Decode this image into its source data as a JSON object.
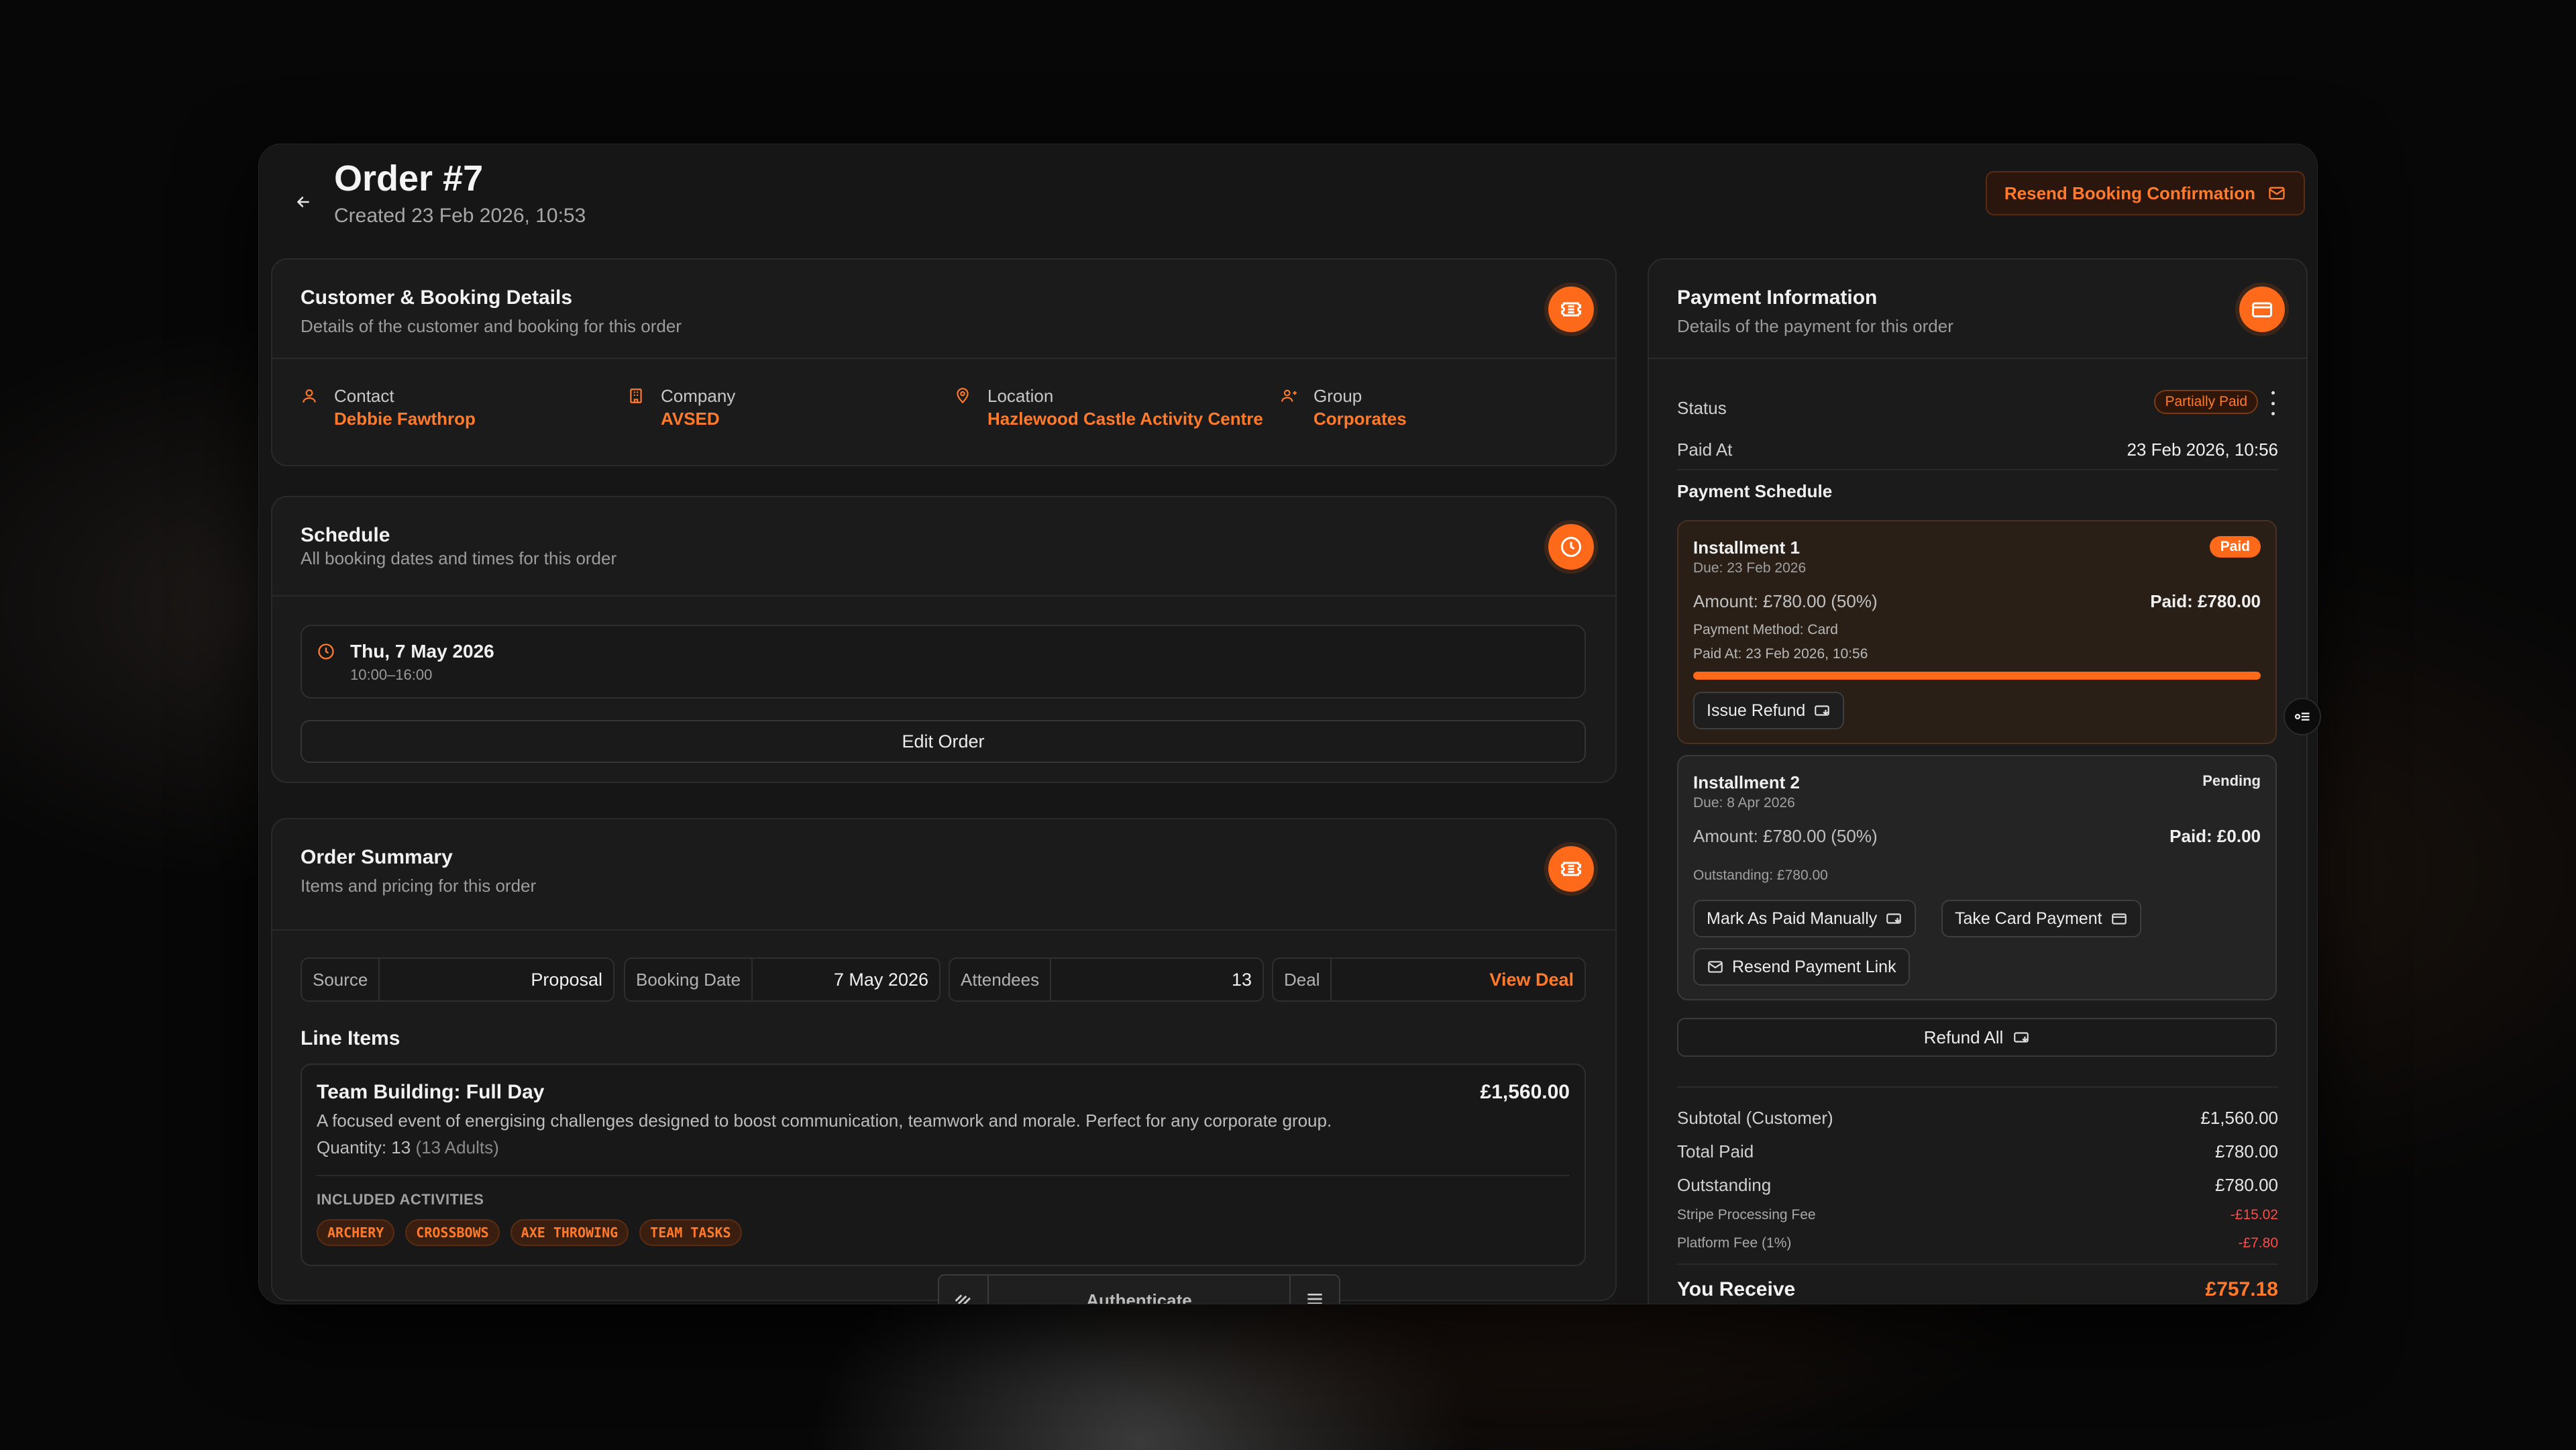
{
  "order": {
    "title": "Order #7",
    "created": "Created 23 Feb 2026, 10:53",
    "resend_label": "Resend Booking Confirmation"
  },
  "customer": {
    "title": "Customer & Booking Details",
    "subtitle": "Details of the customer and booking for this order",
    "contact_label": "Contact",
    "contact_value": "Debbie Fawthrop",
    "company_label": "Company",
    "company_value": "AVSED",
    "location_label": "Location",
    "location_value": "Hazlewood Castle Activity Centre",
    "group_label": "Group",
    "group_value": "Corporates"
  },
  "schedule": {
    "title": "Schedule",
    "subtitle": "All booking dates and times for this order",
    "date": "Thu, 7 May 2026",
    "time": "10:00–16:00",
    "edit_label": "Edit Order"
  },
  "summary": {
    "title": "Order Summary",
    "subtitle": "Items and pricing for this order",
    "source_label": "Source",
    "source_value": "Proposal",
    "booking_date_label": "Booking Date",
    "booking_date_value": "7 May 2026",
    "attendees_label": "Attendees",
    "attendees_value": "13",
    "deal_label": "Deal",
    "deal_value": "View Deal",
    "line_items_label": "Line Items",
    "item": {
      "name": "Team Building: Full Day",
      "price": "£1,560.00",
      "description": "A focused event of energising challenges designed to boost communication, teamwork and morale. Perfect for any corporate group.",
      "quantity": "Quantity: 13",
      "quantity_detail": "(13 Adults)",
      "included_label": "INCLUDED ACTIVITIES",
      "activities": [
        "ARCHERY",
        "CROSSBOWS",
        "AXE THROWING",
        "TEAM TASKS"
      ]
    }
  },
  "auth_bar": {
    "label": "Authenticate"
  },
  "payment": {
    "title": "Payment Information",
    "subtitle": "Details of the payment for this order",
    "status_label": "Status",
    "status_value": "Partially Paid",
    "paid_at_label": "Paid At",
    "paid_at_value": "23 Feb 2026, 10:56",
    "schedule_label": "Payment Schedule",
    "installment1": {
      "name": "Installment 1",
      "badge": "Paid",
      "due": "Due: 23 Feb 2026",
      "amount": "Amount: £780.00 (50%)",
      "paid": "Paid: £780.00",
      "method": "Payment Method: Card",
      "paid_at": "Paid At: 23 Feb 2026, 10:56",
      "progress": 1.0,
      "refund_label": "Issue Refund"
    },
    "installment2": {
      "name": "Installment 2",
      "badge": "Pending",
      "due": "Due: 8 Apr 2026",
      "amount": "Amount: £780.00 (50%)",
      "paid": "Paid: £0.00",
      "outstanding": "Outstanding: £780.00",
      "mark_paid_label": "Mark As Paid Manually",
      "take_card_label": "Take Card Payment",
      "resend_link_label": "Resend Payment Link"
    },
    "refund_all_label": "Refund All",
    "totals": {
      "subtotal_label": "Subtotal (Customer)",
      "subtotal_value": "£1,560.00",
      "total_paid_label": "Total Paid",
      "total_paid_value": "£780.00",
      "outstanding_label": "Outstanding",
      "outstanding_value": "£780.00",
      "stripe_label": "Stripe Processing Fee",
      "stripe_value": "-£15.02",
      "platform_label": "Platform Fee (1%)",
      "platform_value": "-£7.80",
      "receive_label": "You Receive",
      "receive_value": "£757.18"
    }
  },
  "colors": {
    "accent": "#ff6a1a",
    "negative": "#ff4a4a"
  }
}
